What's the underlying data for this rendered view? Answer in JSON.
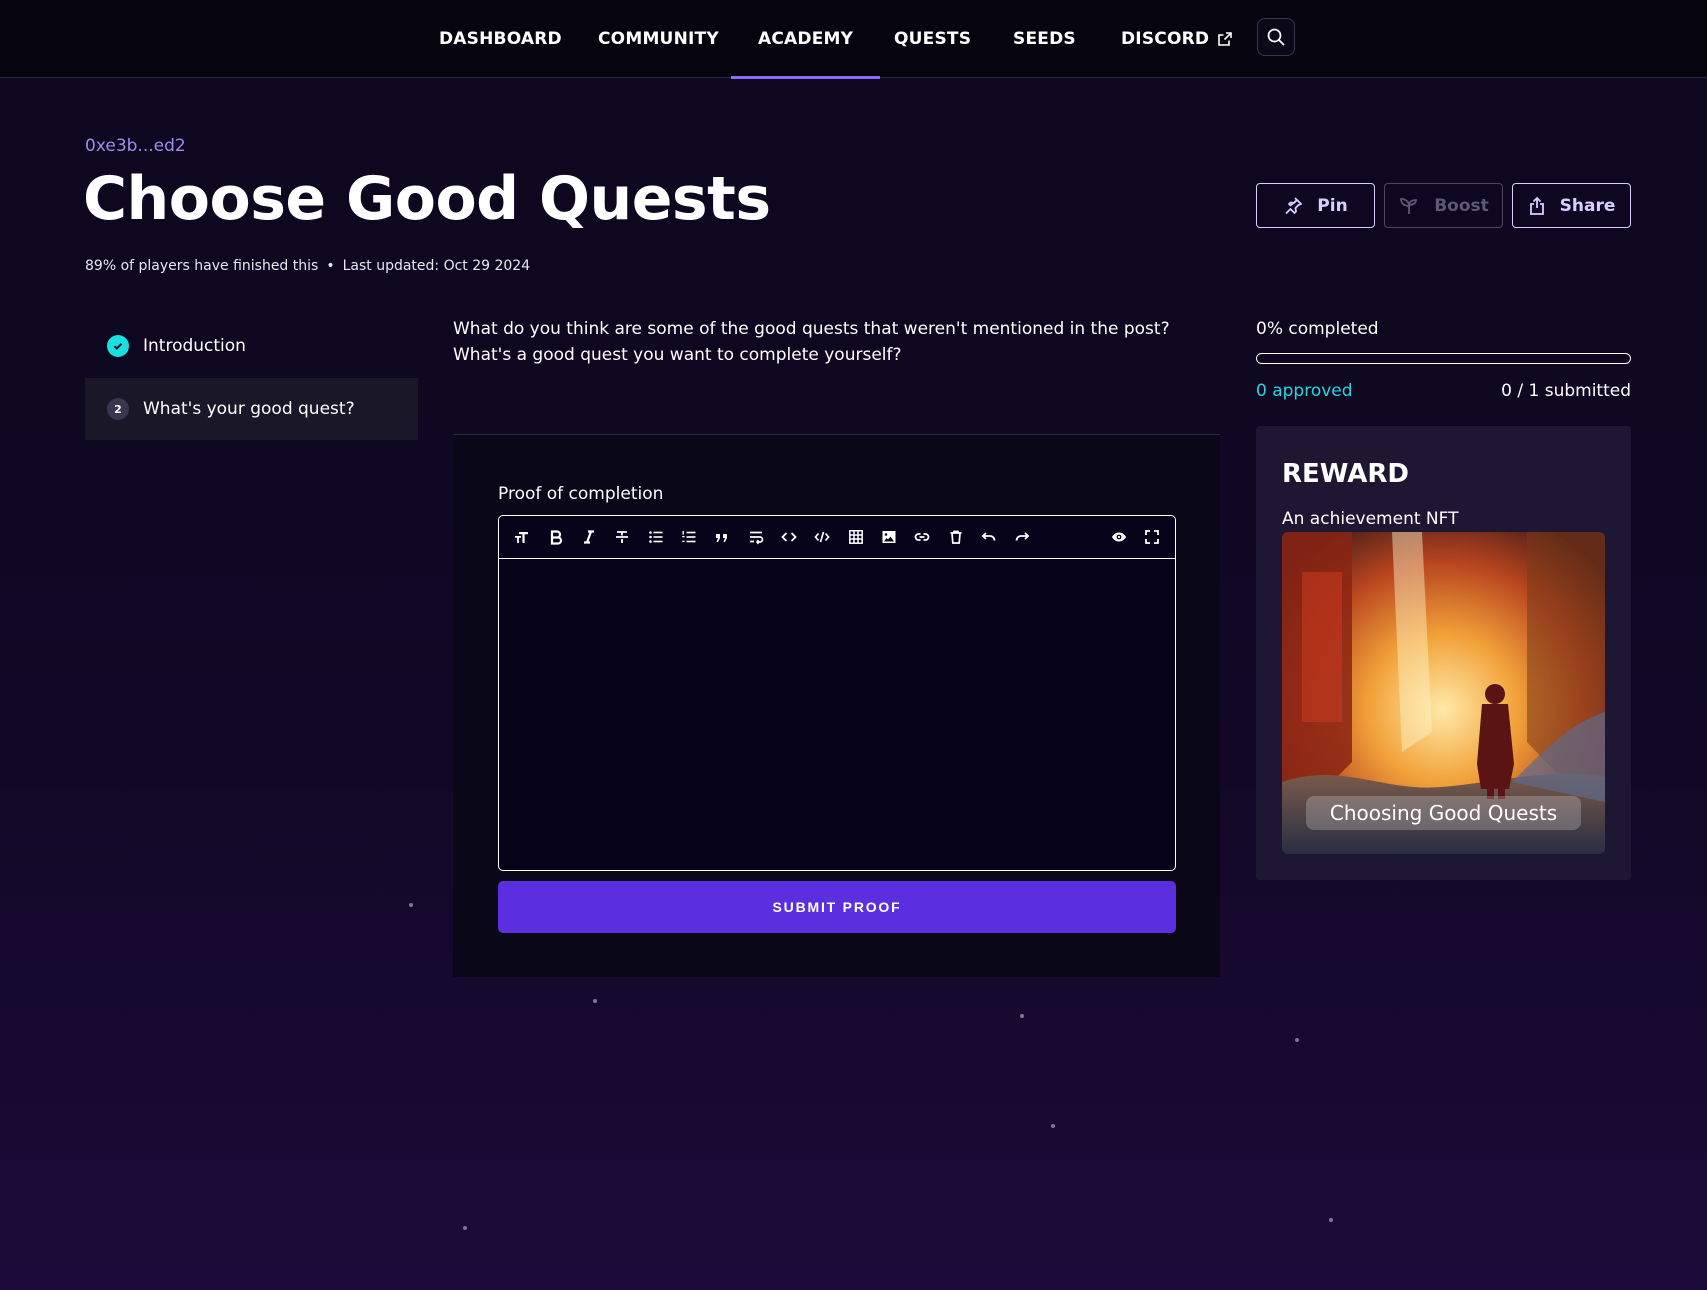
{
  "nav": {
    "items": [
      {
        "label": "DASHBOARD"
      },
      {
        "label": "COMMUNITY"
      },
      {
        "label": "ACADEMY",
        "active": true
      },
      {
        "label": "QUESTS"
      },
      {
        "label": "SEEDS"
      },
      {
        "label": "DISCORD",
        "external": true
      }
    ],
    "search_icon": "search-icon",
    "external_icon": "external-link-icon"
  },
  "quest": {
    "owner": "0xe3b...ed2",
    "title": "Choose Good Quests",
    "finished_text": "89% of players have finished this",
    "updated_text": "Last updated: Oct 29 2024",
    "separator": "•"
  },
  "actions": {
    "pin": "Pin",
    "boost": "Boost",
    "share": "Share"
  },
  "steps": [
    {
      "label": "Introduction",
      "completed": true,
      "badge": ""
    },
    {
      "label": "What's your good quest?",
      "completed": false,
      "badge": "2",
      "active": true
    }
  ],
  "content": {
    "question": "What do you think are some of the good quests that weren't mentioned in the post? What's a good quest you want to complete yourself?",
    "proof_label": "Proof of completion",
    "submit_label": "SUBMIT PROOF",
    "editor_value": ""
  },
  "editor_toolbar": [
    "heading-icon",
    "bold-icon",
    "italic-icon",
    "strikethrough-icon",
    "bullet-list-icon",
    "numbered-list-icon",
    "quote-icon",
    "wrap-icon",
    "code-icon",
    "code-block-icon",
    "table-icon",
    "image-icon",
    "link-icon",
    "trash-icon",
    "undo-icon",
    "redo-icon",
    "preview-icon",
    "fullscreen-icon"
  ],
  "progress": {
    "completed_text": "0% completed",
    "completed_fraction": 0,
    "approved_text": "0 approved",
    "submitted_text": "0 / 1 submitted"
  },
  "reward": {
    "title": "REWARD",
    "description": "An achievement NFT",
    "nft_label": "Choosing Good Quests"
  },
  "colors": {
    "accent": "#8b6cff",
    "primary_button": "#5b2ee0",
    "cyan": "#29d6e0",
    "owner_link": "#a08cf0"
  }
}
